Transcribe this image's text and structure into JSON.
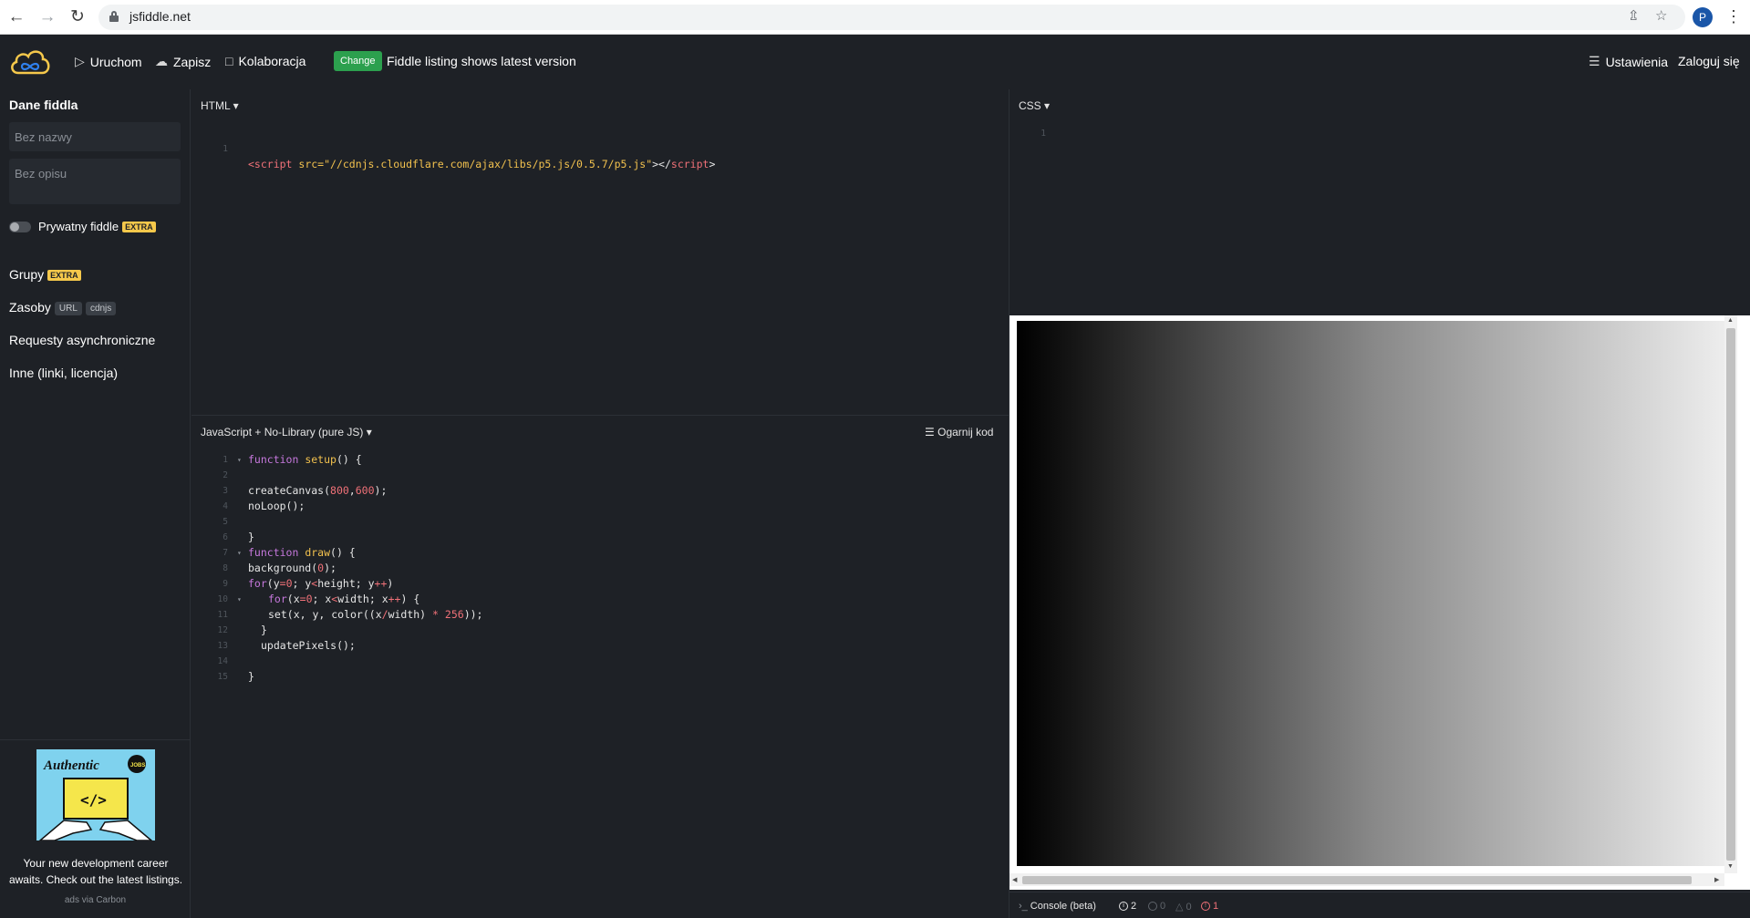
{
  "browser": {
    "url": "jsfiddle.net",
    "profile_initial": "P"
  },
  "header": {
    "run_label": "Uruchom",
    "save_label": "Zapisz",
    "collab_label": "Kolaboracja",
    "change_badge": "Change",
    "change_text": "Fiddle listing shows latest version",
    "settings_label": "Ustawienia",
    "login_label": "Zaloguj się"
  },
  "sidebar": {
    "title": "Dane fiddla",
    "name_placeholder": "Bez nazwy",
    "desc_placeholder": "Bez opisu",
    "private_label": "Prywatny fiddle",
    "extra_badge": "EXTRA",
    "groups_label": "Grupy",
    "resources_label": "Zasoby",
    "url_tag": "URL",
    "cdnjs_tag": "cdnjs",
    "async_label": "Requesty asynchroniczne",
    "other_label": "Inne (linki, licencja)",
    "ad_text": "Your new development career awaits. Check out the latest listings.",
    "ad_via": "ads via Carbon",
    "ad_brand": "Authentic",
    "ad_jobs": "JOBS",
    "ad_code_symbol": "</>"
  },
  "html_panel": {
    "label": "HTML",
    "lines": [
      {
        "n": "1",
        "tag_open": "<script",
        "attr": " src=",
        "value": "\"//cdnjs.cloudflare.com/ajax/libs/p5.js/0.5.7/p5.js\"",
        "close": "></",
        "tag_close": "script",
        "end": ">"
      }
    ]
  },
  "css_panel": {
    "label": "CSS",
    "line_numbers": [
      "1"
    ]
  },
  "js_panel": {
    "label": "JavaScript + No-Library (pure JS)",
    "tidy_label": "Ogarnij kod",
    "lines": [
      {
        "n": "1",
        "fold": true
      },
      {
        "n": "2"
      },
      {
        "n": "3"
      },
      {
        "n": "4"
      },
      {
        "n": "5"
      },
      {
        "n": "6"
      },
      {
        "n": "7",
        "fold": true
      },
      {
        "n": "8"
      },
      {
        "n": "9"
      },
      {
        "n": "10",
        "fold": true
      },
      {
        "n": "11"
      },
      {
        "n": "12"
      },
      {
        "n": "13"
      },
      {
        "n": "14"
      },
      {
        "n": "15"
      }
    ],
    "code": {
      "l1_kw": "function",
      "l1_fn": "setup",
      "l1_rest": "() {",
      "l3_a": "createCanvas(",
      "l3_n1": "800",
      "l3_b": ",",
      "l3_n2": "600",
      "l3_c": ");",
      "l4": "noLoop();",
      "l6": "}",
      "l7_kw": "function",
      "l7_fn": "draw",
      "l7_rest": "() {",
      "l8_a": "background(",
      "l8_n": "0",
      "l8_b": ");",
      "l9_kw": "for",
      "l9_a": "(y",
      "l9_op1": "=",
      "l9_n": "0",
      "l9_b": "; y",
      "l9_op2": "<",
      "l9_c": "height; y",
      "l9_op3": "++",
      "l9_d": ")",
      "l10_kw": "for",
      "l10_a": "(x",
      "l10_op1": "=",
      "l10_n": "0",
      "l10_b": "; x",
      "l10_op2": "<",
      "l10_c": "width; x",
      "l10_op3": "++",
      "l10_d": ") {",
      "l11_a": "set(x, y, color((x",
      "l11_op1": "/",
      "l11_b": "width) ",
      "l11_op2": "*",
      "l11_c": " ",
      "l11_n": "256",
      "l11_d": "));",
      "l12": "}",
      "l13": "updatePixels();",
      "l15": "}"
    }
  },
  "console": {
    "label": "Console (beta)",
    "info_count": "2",
    "log_count": "0",
    "warn_count": "0",
    "error_count": "1"
  },
  "colors": {
    "background": "#1e2126",
    "change_green": "#2ca04e",
    "extra_yellow": "#f5c84b",
    "keyword": "#c678dd",
    "function_name": "#f2c14e",
    "number": "#f07178"
  }
}
